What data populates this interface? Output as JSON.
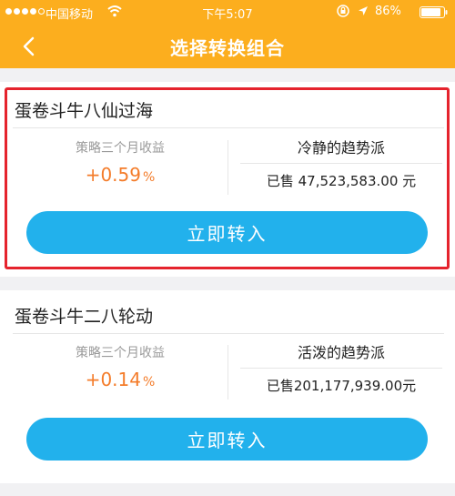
{
  "status_bar": {
    "carrier": "中国移动",
    "time": "下午5:07",
    "battery": "86%"
  },
  "nav": {
    "title": "选择转换组合",
    "back_icon": "chevron-left-icon"
  },
  "colors": {
    "header": "#fcae1e",
    "highlight_border": "#e5232d",
    "return_value": "#f47c2a",
    "button": "#22b1ec"
  },
  "portfolios": [
    {
      "name": "蛋卷斗牛八仙过海",
      "return_label": "策略三个月收益",
      "return_value": "+0.59",
      "return_unit": "%",
      "style": "冷静的趋势派",
      "sold": "已售  47,523,583.00 元",
      "button": "立即转入",
      "highlighted": true
    },
    {
      "name": "蛋卷斗牛二八轮动",
      "return_label": "策略三个月收益",
      "return_value": "+0.14",
      "return_unit": "%",
      "style": "活泼的趋势派",
      "sold": "已售201,177,939.00元",
      "button": "立即转入",
      "highlighted": false
    }
  ]
}
